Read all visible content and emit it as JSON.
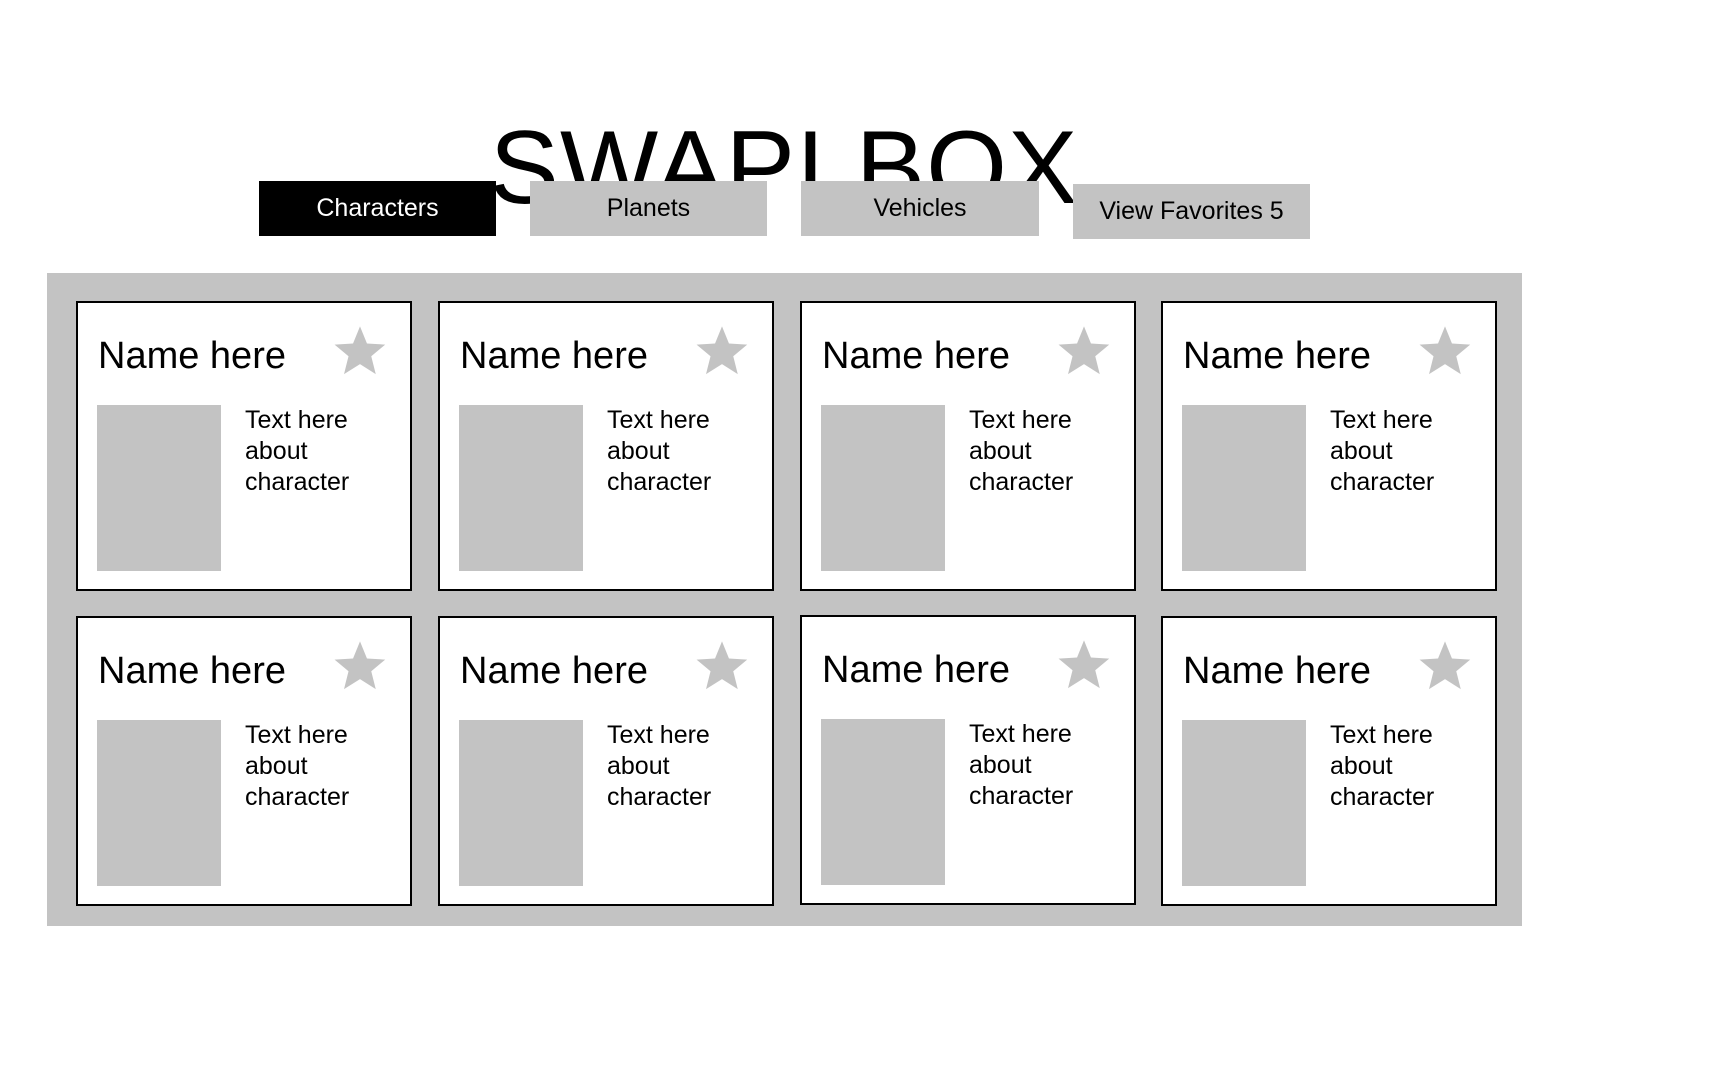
{
  "app": {
    "title": "SWAPI BOX"
  },
  "nav": {
    "buttons": [
      {
        "label": "Characters",
        "active": true
      },
      {
        "label": "Planets",
        "active": false
      },
      {
        "label": "Vehicles",
        "active": false
      },
      {
        "label": "View Favorites 5",
        "active": false
      }
    ]
  },
  "colors": {
    "placeholder_gray": "#c3c3c3",
    "active_button": "#000000",
    "star": "#c3c3c3"
  },
  "cards": [
    {
      "name": "Name here",
      "description": "Text here about character",
      "icon": "star-icon",
      "favorited": false
    },
    {
      "name": "Name here",
      "description": "Text here about character",
      "icon": "star-icon",
      "favorited": false
    },
    {
      "name": "Name here",
      "description": "Text here about character",
      "icon": "star-icon",
      "favorited": false
    },
    {
      "name": "Name here",
      "description": "Text here about character",
      "icon": "star-icon",
      "favorited": false
    },
    {
      "name": "Name here",
      "description": "Text here about character",
      "icon": "star-icon",
      "favorited": false
    },
    {
      "name": "Name here",
      "description": "Text here about character",
      "icon": "star-icon",
      "favorited": false
    },
    {
      "name": "Name here",
      "description": "Text here about character",
      "icon": "star-icon",
      "favorited": false
    },
    {
      "name": "Name here",
      "description": "Text here about character",
      "icon": "star-icon",
      "favorited": false
    }
  ]
}
